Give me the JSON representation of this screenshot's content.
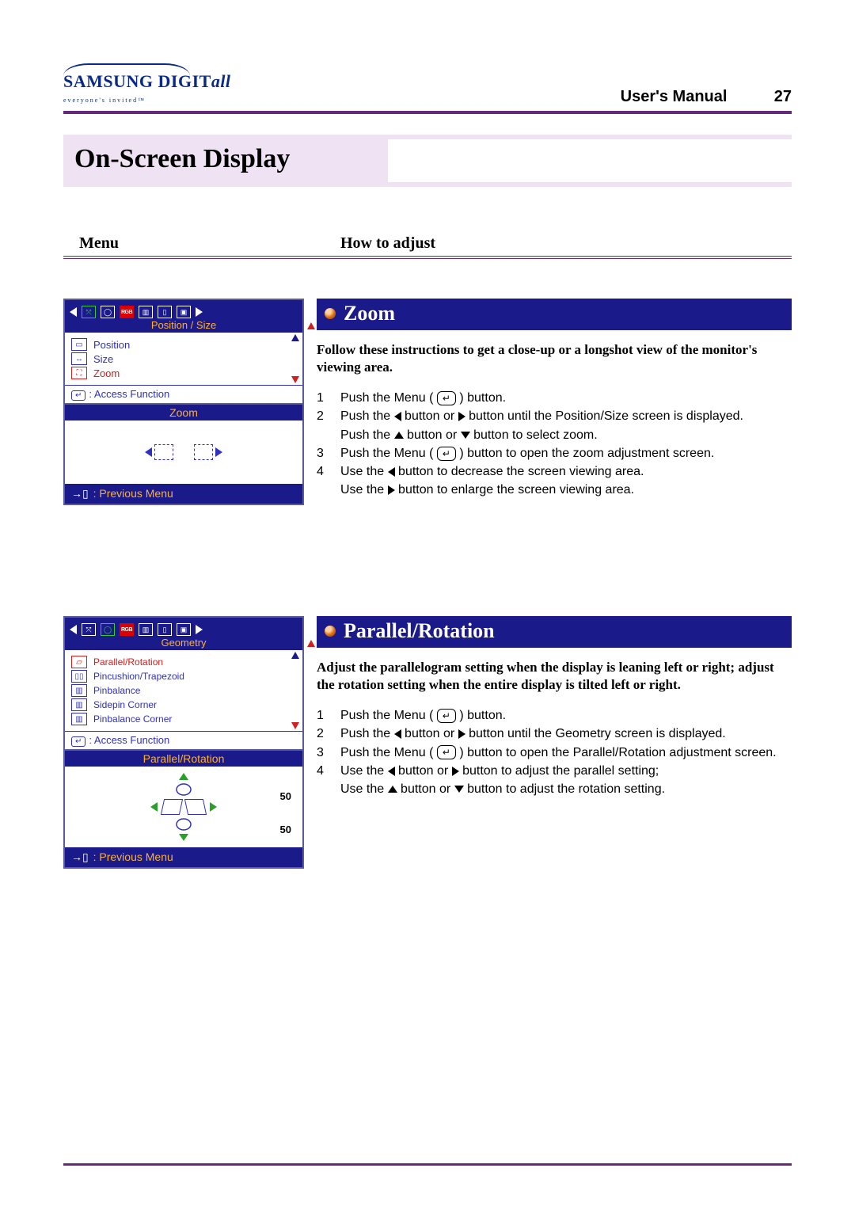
{
  "logo": {
    "brand_a": "SAMSUNG",
    "brand_b": "DIGIT",
    "brand_c": "all",
    "tagline": "everyone's invited™"
  },
  "header": {
    "title": "User's Manual",
    "page": "27"
  },
  "section_title": "On-Screen Display",
  "col_headers": {
    "menu": "Menu",
    "how": "How to adjust"
  },
  "zoom": {
    "bar": "Zoom",
    "intro": "Follow these instructions to get a close-up or a longshot view of the monitor's viewing area.",
    "steps": [
      {
        "n": "1",
        "t": "Push the Menu ( ↵ ) button."
      },
      {
        "n": "2",
        "t": "Push the ◀ button or ▶ button until the Position/Size screen is displayed. Push the ▲ button or ▼ button to select zoom."
      },
      {
        "n": "3",
        "t": "Push the Menu ( ↵ ) button to open the zoom adjustment screen."
      },
      {
        "n": "4",
        "t": "Use the ◀ button to decrease the screen viewing area. Use the ▶ button to enlarge the screen viewing area."
      }
    ],
    "osd": {
      "top_sub": "Position / Size",
      "items": [
        {
          "label": "Position",
          "sel": false
        },
        {
          "label": "Size",
          "sel": false
        },
        {
          "label": "Zoom",
          "sel": true
        }
      ],
      "access": ": Access Function",
      "ctrl_title": "Zoom",
      "prev": ": Previous Menu"
    }
  },
  "parallel": {
    "bar": "Parallel/Rotation",
    "intro": "Adjust the parallelogram setting when the display is leaning left or right; adjust the rotation setting when the entire display is tilted left or right.",
    "steps": [
      {
        "n": "1",
        "t": "Push the Menu ( ↵ ) button."
      },
      {
        "n": "2",
        "t": "Push the ◀ button or ▶ button until the  Geometry screen is displayed."
      },
      {
        "n": "3",
        "t": "Push the Menu ( ↵ ) button to open the Parallel/Rotation adjustment screen."
      },
      {
        "n": "4",
        "t": "Use the ◀ button or ▶ button to adjust the parallel setting; Use the ▲ button or ▼ button to adjust the rotation setting."
      }
    ],
    "osd": {
      "top_sub": "Geometry",
      "items": [
        {
          "label": "Parallel/Rotation",
          "sel": true
        },
        {
          "label": "Pincushion/Trapezoid",
          "sel": false
        },
        {
          "label": "Pinbalance",
          "sel": false
        },
        {
          "label": "Sidepin Corner",
          "sel": false
        },
        {
          "label": "Pinbalance Corner",
          "sel": false
        }
      ],
      "access": ": Access Function",
      "ctrl_title": "Parallel/Rotation",
      "val1": "50",
      "val2": "50",
      "prev": ": Previous Menu"
    }
  }
}
